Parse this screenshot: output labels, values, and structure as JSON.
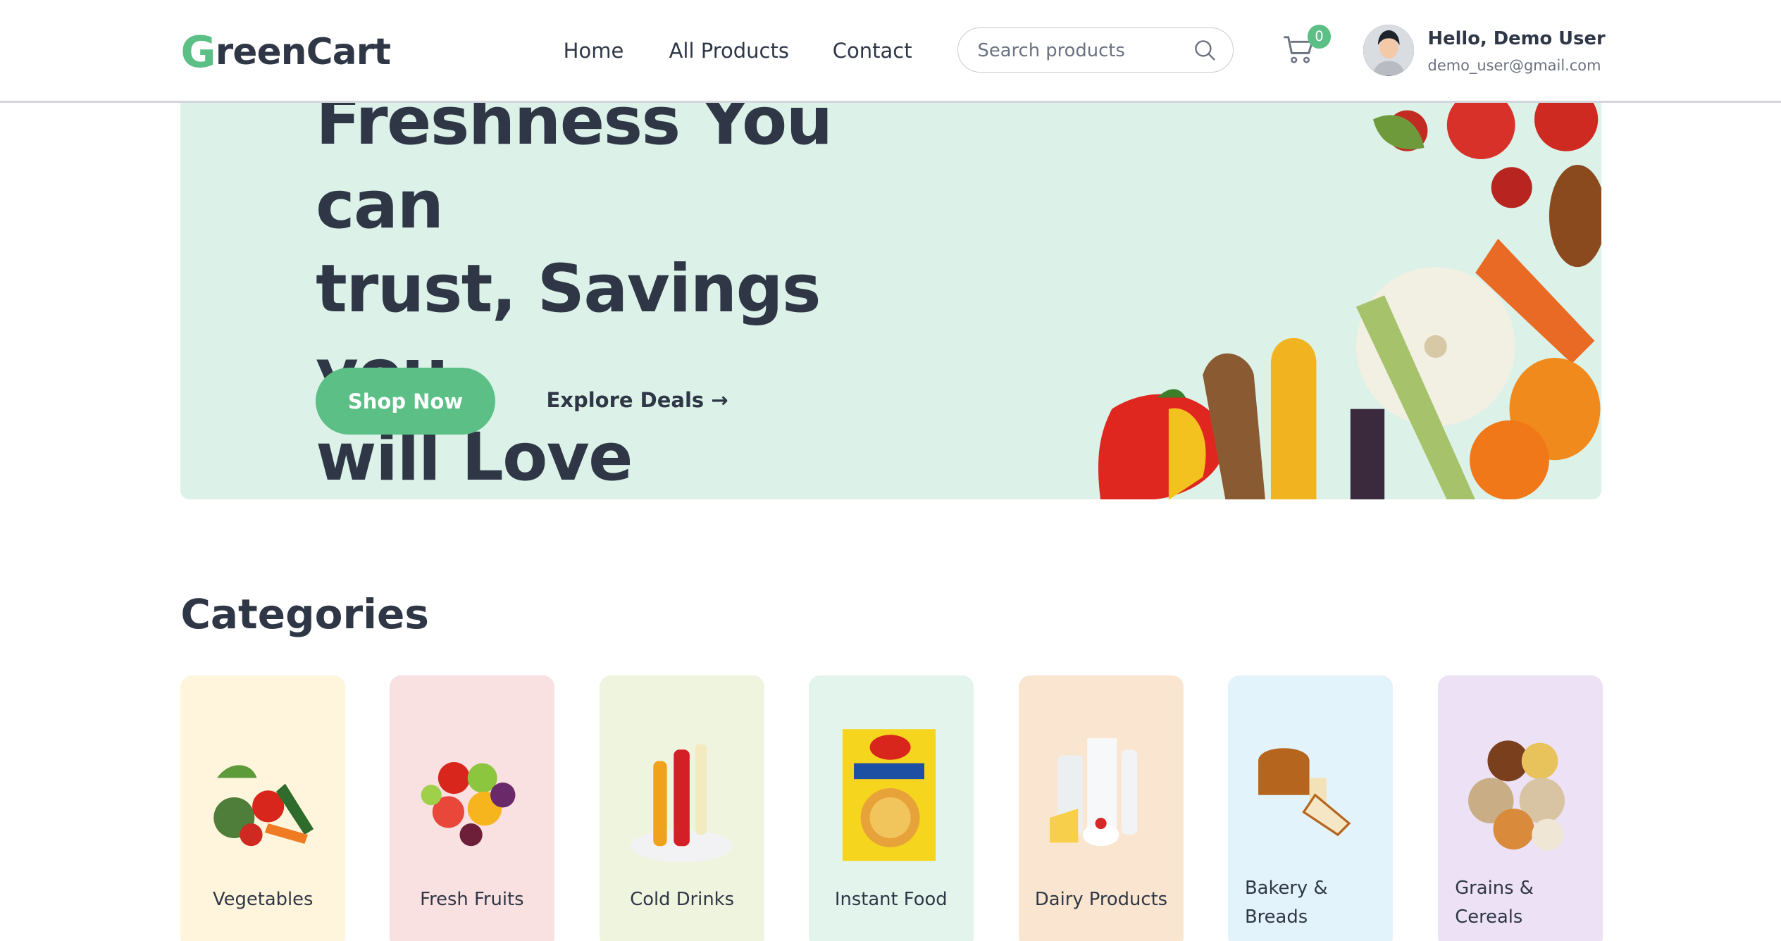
{
  "header": {
    "logo_first": "G",
    "logo_rest": "reenCart",
    "nav": [
      "Home",
      "All Products",
      "Contact"
    ],
    "search_placeholder": "Search products",
    "cart_count": "0",
    "greeting": "Hello, Demo User",
    "email": "demo_user@gmail.com"
  },
  "hero": {
    "headline_lines": [
      "Freshness You can",
      "trust, Savings you",
      "will Love"
    ],
    "primary_cta": "Shop Now",
    "secondary_cta": "Explore Deals"
  },
  "categories": {
    "title": "Categories",
    "items": [
      {
        "label": "Vegetables",
        "color": "#fef5dc"
      },
      {
        "label": "Fresh Fruits",
        "color": "#f9e0e1"
      },
      {
        "label": "Cold Drinks",
        "color": "#eff4df"
      },
      {
        "label": "Instant Food",
        "color": "#e3f4ec"
      },
      {
        "label": "Dairy Products",
        "color": "#fae6d0"
      },
      {
        "label": "Bakery & Breads",
        "color": "#e3f3fb"
      },
      {
        "label": "Grains & Cereals",
        "color": "#ede1f5"
      }
    ]
  },
  "colors": {
    "brand": "#5bbf86",
    "text": "#2f3747"
  }
}
